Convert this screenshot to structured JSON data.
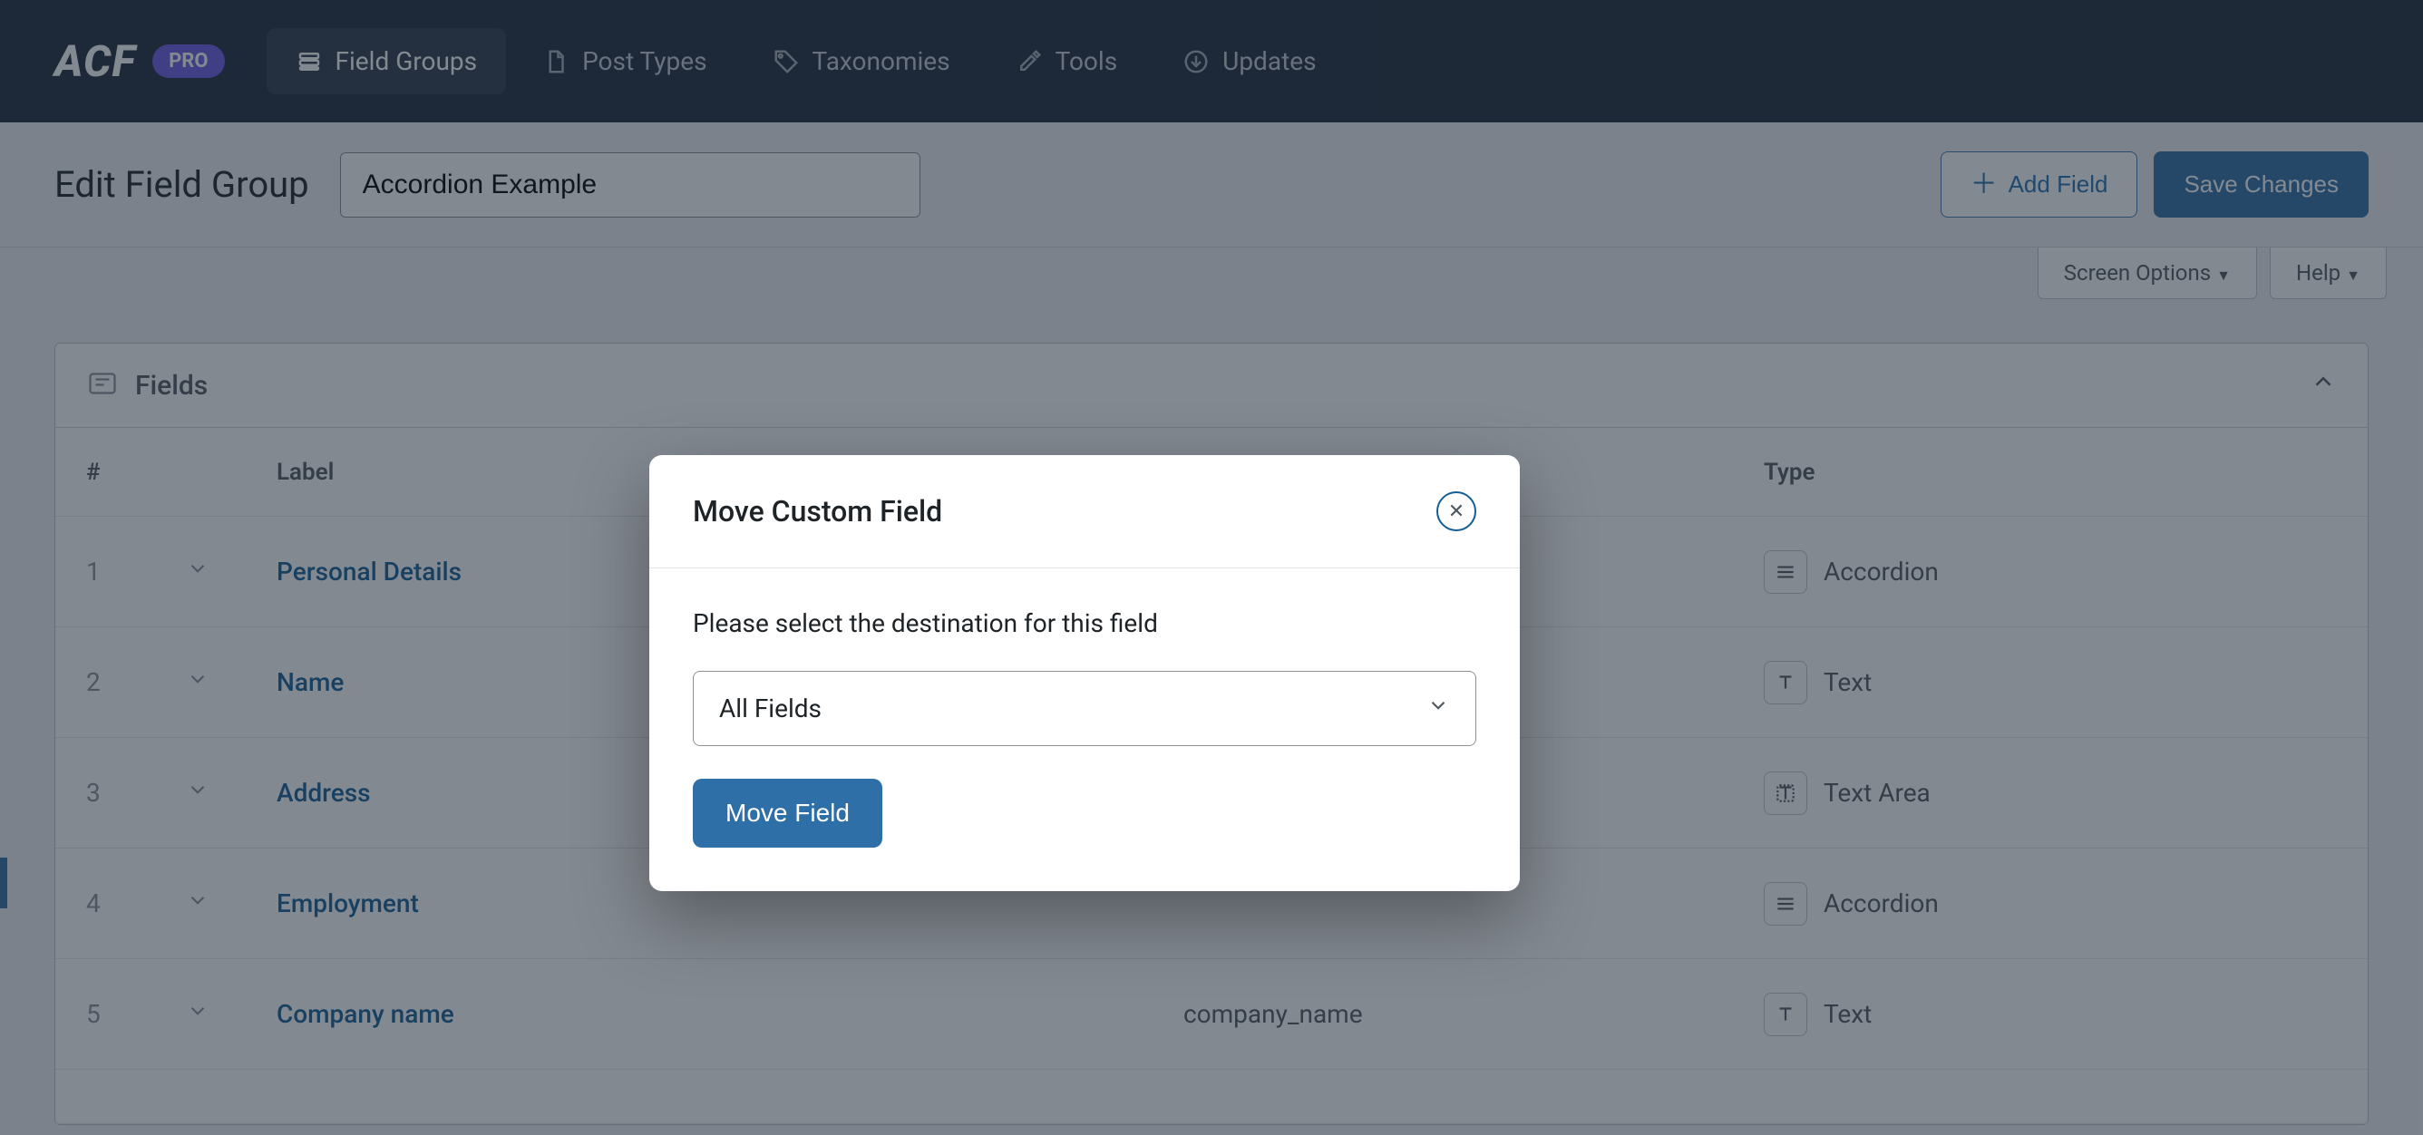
{
  "brand": {
    "logo_text": "ACF",
    "pro_badge": "PRO"
  },
  "nav": {
    "field_groups": "Field Groups",
    "post_types": "Post Types",
    "taxonomies": "Taxonomies",
    "tools": "Tools",
    "updates": "Updates"
  },
  "header": {
    "page_title": "Edit Field Group",
    "group_name_value": "Accordion Example",
    "add_field": "Add Field",
    "save_changes": "Save Changes"
  },
  "screen_tabs": {
    "screen_options": "Screen Options",
    "help": "Help"
  },
  "panel": {
    "title": "Fields"
  },
  "columns": {
    "num": "#",
    "label": "Label",
    "type": "Type"
  },
  "rows": [
    {
      "n": "1",
      "label": "Personal Details",
      "name": "",
      "type": "Accordion",
      "type_icon": "accordion"
    },
    {
      "n": "2",
      "label": "Name",
      "name": "",
      "type": "Text",
      "type_icon": "text"
    },
    {
      "n": "3",
      "label": "Address",
      "name": "",
      "type": "Text Area",
      "type_icon": "textarea"
    },
    {
      "n": "4",
      "label": "Employment",
      "name": "",
      "type": "Accordion",
      "type_icon": "accordion"
    },
    {
      "n": "5",
      "label": "Company name",
      "name": "company_name",
      "type": "Text",
      "type_icon": "text"
    }
  ],
  "modal": {
    "title": "Move Custom Field",
    "prompt": "Please select the destination for this field",
    "select_value": "All Fields",
    "submit": "Move Field"
  }
}
